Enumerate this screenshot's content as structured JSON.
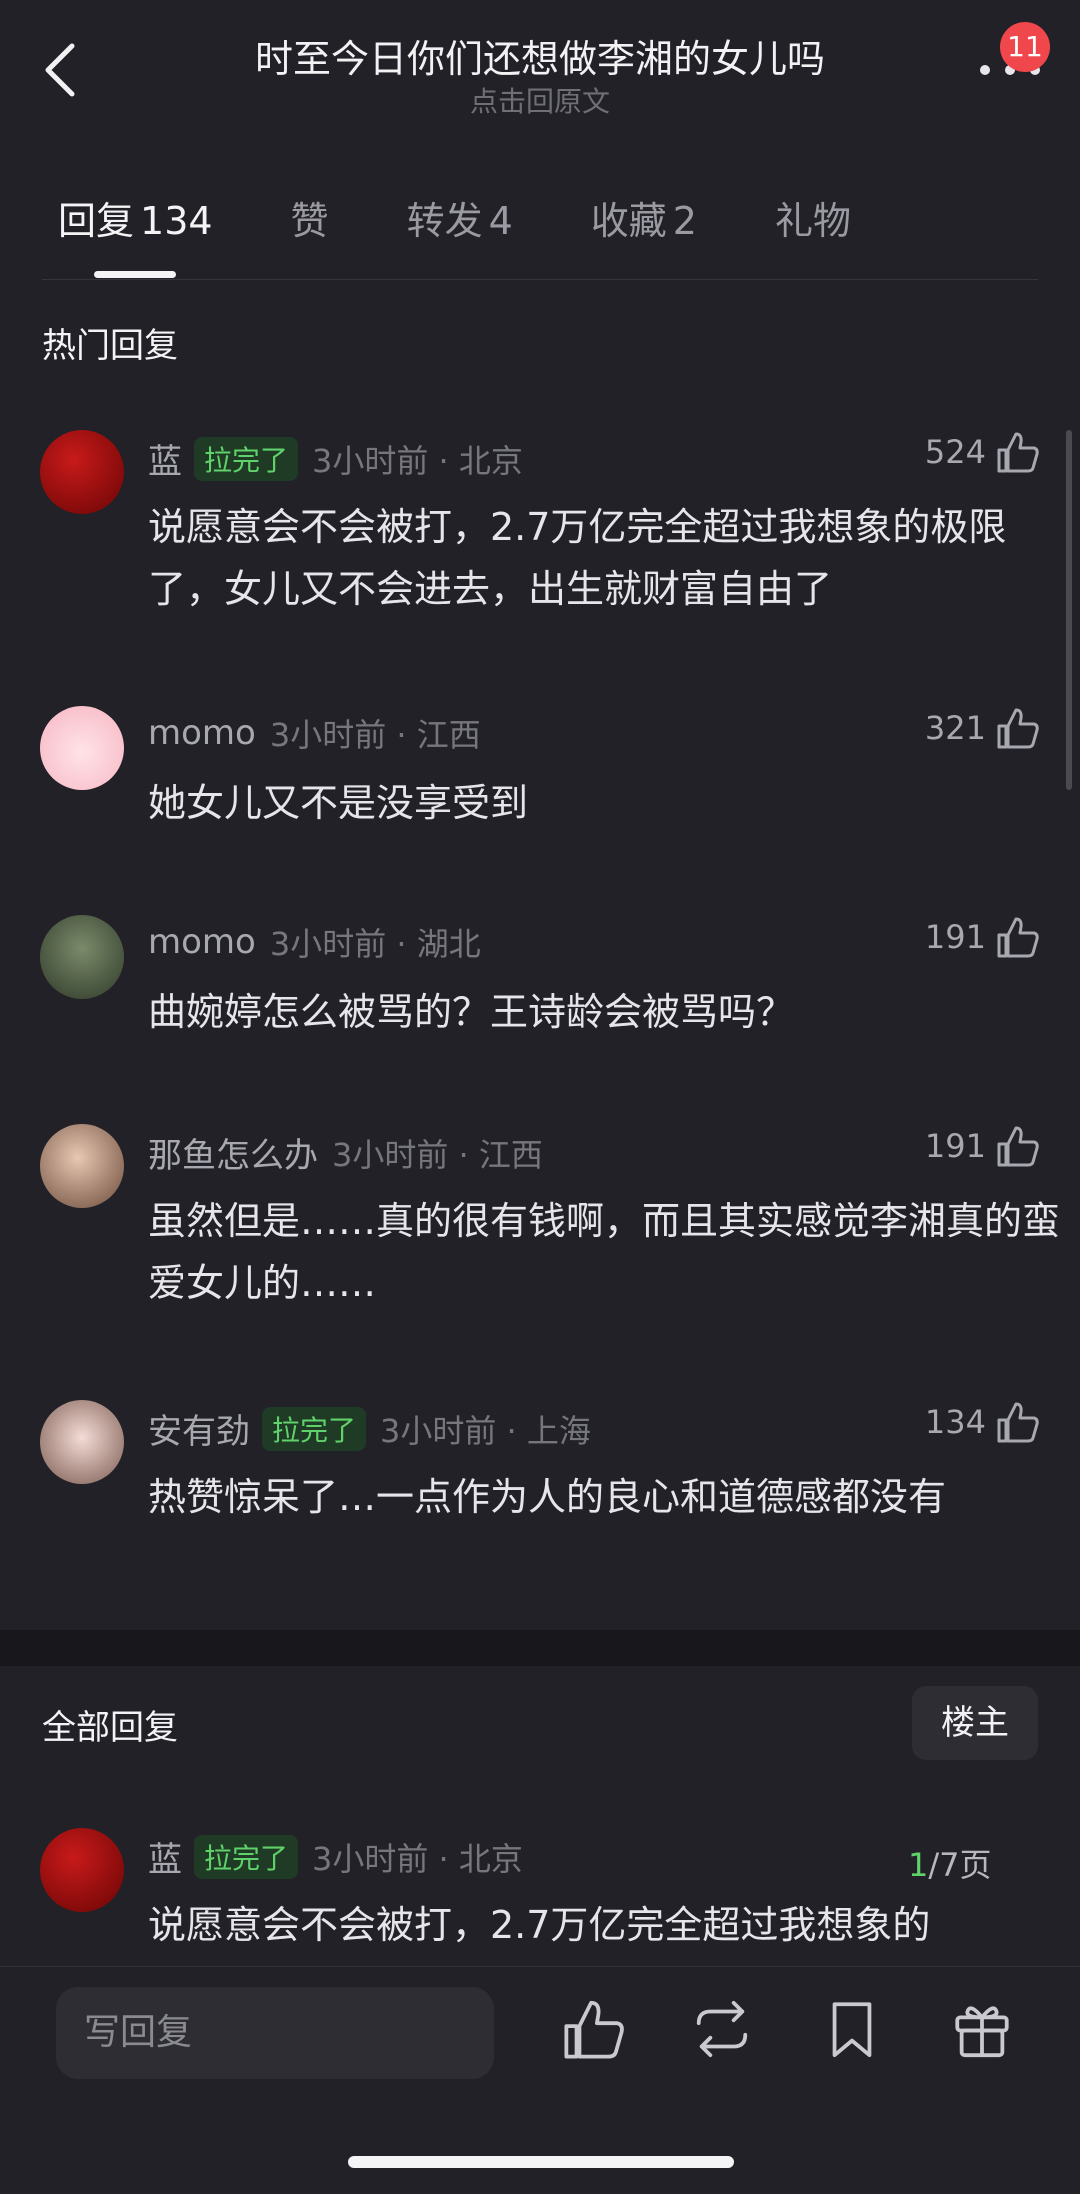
{
  "header": {
    "title": "时至今日你们还想做李湘的女儿吗",
    "subtitle": "点击回原文",
    "notification_count": "11"
  },
  "tabs": [
    {
      "label": "回复",
      "count": "134",
      "active": true
    },
    {
      "label": "赞",
      "count": ""
    },
    {
      "label": "转发",
      "count": "4"
    },
    {
      "label": "收藏",
      "count": "2"
    },
    {
      "label": "礼物",
      "count": ""
    }
  ],
  "hot_section": {
    "title": "热门回复"
  },
  "hot_comments": [
    {
      "name": "蓝",
      "tag": "拉完了",
      "time": "3小时前 · 北京",
      "likes": "524",
      "text": "说愿意会不会被打，2.7万亿完全超过我想象的极限了，女儿又不会进去，出生就财富自由了"
    },
    {
      "name": "momo",
      "tag": "",
      "time": "3小时前 · 江西",
      "likes": "321",
      "text": "她女儿又不是没享受到"
    },
    {
      "name": "momo",
      "tag": "",
      "time": "3小时前 · 湖北",
      "likes": "191",
      "text": "曲婉婷怎么被骂的？王诗龄会被骂吗？"
    },
    {
      "name": "那鱼怎么办",
      "tag": "",
      "time": "3小时前 · 江西",
      "likes": "191",
      "text": "虽然但是……真的很有钱啊，而且其实感觉李湘真的蛮爱女儿的……"
    },
    {
      "name": "安有劲",
      "tag": "拉完了",
      "time": "3小时前 · 上海",
      "likes": "134",
      "text": "热赞惊呆了…一点作为人的良心和道德感都没有"
    }
  ],
  "all_section": {
    "title": "全部回复",
    "owner_button": "楼主"
  },
  "all_comments": [
    {
      "name": "蓝",
      "tag": "拉完了",
      "time": "3小时前 · 北京",
      "text": "说愿意会不会被打，2.7万亿完全超过我想象的"
    }
  ],
  "pagination": {
    "current": "1",
    "total_text": "/7页"
  },
  "bottom_bar": {
    "reply_placeholder": "写回复"
  }
}
